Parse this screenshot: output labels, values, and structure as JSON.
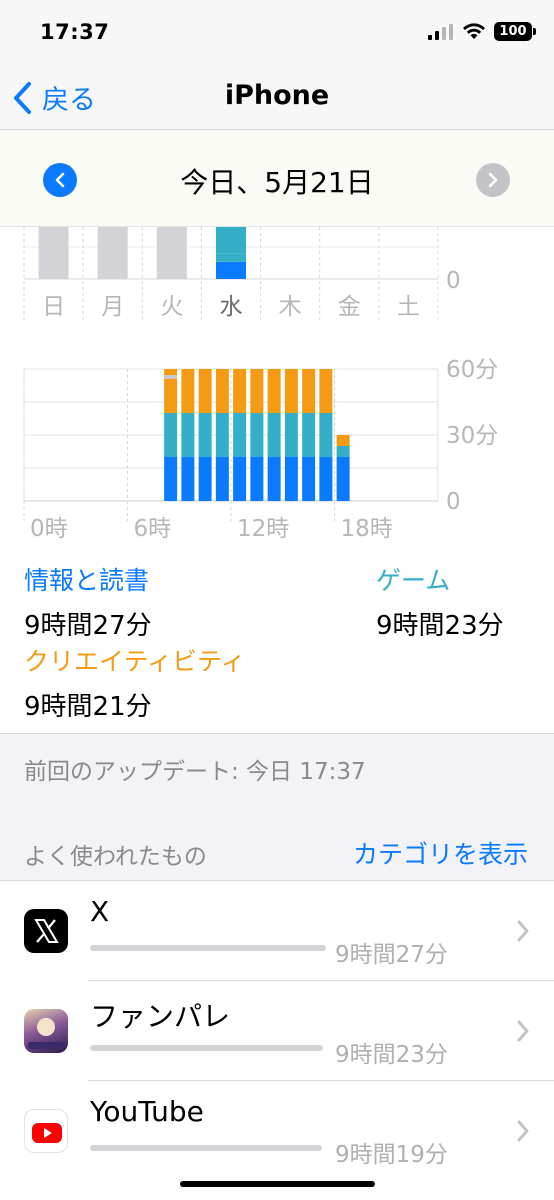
{
  "status": {
    "time": "17:37",
    "battery": "100"
  },
  "nav": {
    "back_label": "戻る",
    "title": "iPhone"
  },
  "date": {
    "label": "今日、5月21日"
  },
  "chart_data": [
    {
      "type": "bar",
      "categories": [
        "日",
        "月",
        "火",
        "水",
        "木",
        "金",
        "土"
      ],
      "series": [
        {
          "values": [
            null,
            null,
            null,
            0.19
          ]
        },
        {
          "values": [
            null,
            null,
            null,
            0.09
          ]
        },
        {
          "values": [
            0.58,
            0.58,
            0.58,
            0
          ]
        }
      ],
      "yticks": [
        "0"
      ],
      "highlight_category": "水",
      "grid": true
    },
    {
      "type": "bar",
      "stacked": true,
      "x": [
        0,
        1,
        2,
        3,
        4,
        5,
        6,
        7,
        8,
        9,
        10,
        11,
        12,
        13,
        14,
        15,
        16,
        17,
        18,
        19,
        20,
        21,
        22,
        23
      ],
      "xticks": [
        "0時",
        "6時",
        "12時",
        "18時"
      ],
      "yticks": [
        "60分",
        "30分",
        "0"
      ],
      "ylim": [
        0,
        60
      ],
      "series": [
        {
          "name": "情報と読書",
          "color": "#0a7aff",
          "values": [
            0,
            0,
            0,
            0,
            0,
            0,
            0,
            0,
            20,
            20,
            20,
            20,
            20,
            20,
            20,
            20,
            20,
            20,
            20,
            0,
            0,
            0,
            0,
            0
          ]
        },
        {
          "name": "ゲーム",
          "color": "#35aec7",
          "values": [
            0,
            0,
            0,
            0,
            0,
            0,
            0,
            0,
            20,
            20,
            20,
            20,
            20,
            20,
            20,
            20,
            20,
            20,
            5,
            0,
            0,
            0,
            0,
            0
          ]
        },
        {
          "name": "クリエイティビティ",
          "color": "#f49b14",
          "values": [
            0,
            0,
            0,
            0,
            0,
            0,
            0,
            0,
            20,
            20,
            20,
            20,
            20,
            20,
            20,
            20,
            20,
            20,
            5,
            0,
            0,
            0,
            0,
            0
          ]
        }
      ],
      "grid": true
    }
  ],
  "categories": [
    {
      "name": "情報と読書",
      "time": "9時間27分",
      "color": "#0a7aff"
    },
    {
      "name": "ゲーム",
      "time": "9時間23分",
      "color": "#35aec7"
    },
    {
      "name": "クリエイティビティ",
      "time": "9時間21分",
      "color": "#f49b14"
    }
  ],
  "updated": "前回のアップデート: 今日 17:37",
  "most_used": {
    "title": "よく使われたもの",
    "link": "カテゴリを表示",
    "apps": [
      {
        "name": "X",
        "time": "9時間27分",
        "fraction": 1.0,
        "icon": "x-logo-icon"
      },
      {
        "name": "ファンパレ",
        "time": "9時間23分",
        "fraction": 0.99,
        "icon": "fanpare-icon"
      },
      {
        "name": "YouTube",
        "time": "9時間19分",
        "fraction": 0.985,
        "icon": "youtube-icon"
      }
    ]
  }
}
